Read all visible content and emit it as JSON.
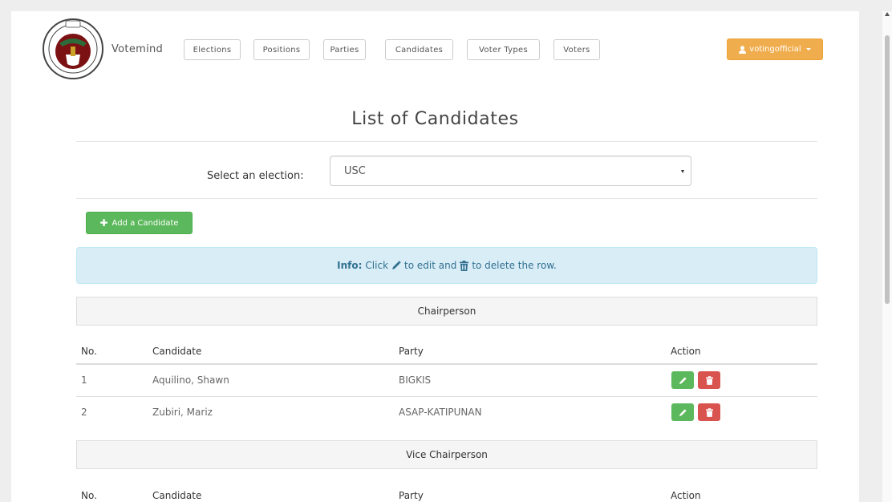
{
  "navbar": {
    "brand": "Votemind",
    "links": [
      "Elections",
      "Positions",
      "Parties",
      "Candidates",
      "Voter Types",
      "Voters"
    ],
    "user": "votingofficial"
  },
  "page_title": "List of Candidates",
  "election_select": {
    "label": "Select an election:",
    "value": "USC"
  },
  "add_button": "Add a Candidate",
  "info": {
    "prefix": "Info:",
    "text_click": "Click",
    "text_middle": "to edit and",
    "text_end": "to delete the row."
  },
  "table_headers": {
    "no": "No.",
    "candidate": "Candidate",
    "party": "Party",
    "action": "Action"
  },
  "sections": [
    {
      "position": "Chairperson",
      "rows": [
        {
          "no": "1",
          "candidate": "Aquilino, Shawn",
          "party": "BIGKIS"
        },
        {
          "no": "2",
          "candidate": "Zubiri, Mariz",
          "party": "ASAP-KATIPUNAN"
        }
      ]
    },
    {
      "position": "Vice Chairperson",
      "rows": []
    }
  ],
  "colors": {
    "accent_orange": "#f0ad4e",
    "success_green": "#5cb85c",
    "danger_red": "#d9534f",
    "info_bg": "#d9edf7"
  },
  "icons": {
    "user": "user-icon",
    "plus": "plus-icon",
    "edit": "pencil-icon",
    "delete": "trash-icon"
  }
}
